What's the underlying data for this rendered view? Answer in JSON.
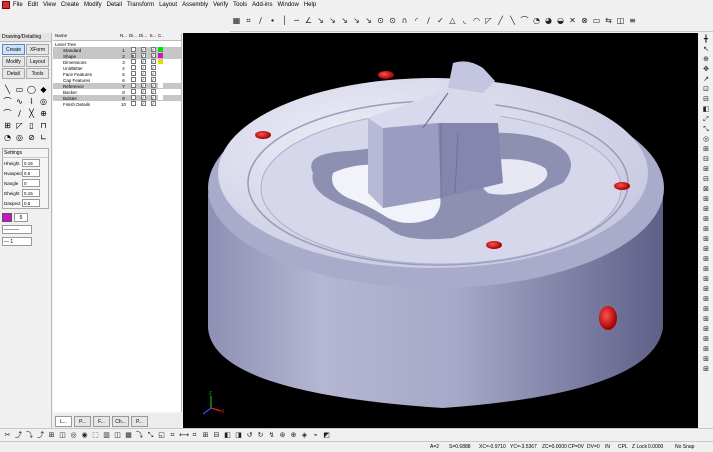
{
  "menu": [
    "File",
    "Edit",
    "View",
    "Create",
    "Modify",
    "Detail",
    "Transform",
    "Layout",
    "Assembly",
    "Verify",
    "Tools",
    "Add-ins",
    "Window",
    "Help"
  ],
  "top_toolbar_icons": [
    "▦",
    "⌗",
    "∕",
    "∙",
    "│",
    "─",
    "∠",
    "↘",
    "↘",
    "↘",
    "↘",
    "↘",
    "⊙",
    "⊙",
    "∩",
    "◜",
    "∕",
    "✓",
    "△",
    "◟",
    "◠",
    "◸",
    "╱",
    "╲",
    "⌒",
    "◔",
    "◕",
    "◒",
    "✕",
    "⊗",
    "▭",
    "⇆",
    "◫",
    "≡"
  ],
  "left_panel": {
    "title": "Drawing/Detailing",
    "tabs": [
      "Create",
      "XForm",
      "Modify",
      "Layout",
      "Detail",
      "Tools"
    ],
    "active_tab": "Create",
    "tool_icons": [
      "╲",
      "▭",
      "◯",
      "◆",
      "⌒",
      "∿",
      "⌇",
      "◎",
      "⌒",
      "∕",
      "╳",
      "⊕",
      "⊞",
      "◸",
      "▯",
      "⊓",
      "◔",
      "◎",
      "⊘",
      "∟"
    ],
    "settings": {
      "title": "Settings",
      "rows": [
        {
          "label": "Hheight",
          "value": "0.15"
        },
        {
          "label": "Nvaspect",
          "value": "0.5"
        },
        {
          "label": "Nangle",
          "value": "0"
        },
        {
          "label": "Dheight",
          "value": "0.15"
        },
        {
          "label": "Daspect",
          "value": "0.5"
        }
      ]
    },
    "color_value": "5",
    "line_style_1": "———",
    "line_style_2": "— 1"
  },
  "level_tree": {
    "headers": [
      "Name",
      "N...",
      "Di...",
      "Di...",
      "S...",
      "C..."
    ],
    "root": "Level Tree",
    "rows": [
      {
        "name": "Standard",
        "n": "1",
        "selected": true,
        "color": "#00e000"
      },
      {
        "name": "Shape",
        "n": "2",
        "selected": true,
        "color": "#d010d0"
      },
      {
        "name": "Dimensions",
        "n": "3",
        "selected": false,
        "color": "#e0e000"
      },
      {
        "name": "Unit/Bitter",
        "n": "4",
        "selected": false,
        "color": "#ffffff"
      },
      {
        "name": "Face Features",
        "n": "5",
        "selected": false,
        "color": "#ffffff"
      },
      {
        "name": "Cap Features",
        "n": "6",
        "selected": false,
        "color": "#ffffff"
      },
      {
        "name": "Reference",
        "n": "7",
        "selected": true,
        "color": "#ffffff"
      },
      {
        "name": "Backer",
        "n": "8",
        "selected": false,
        "color": "#ffffff"
      },
      {
        "name": "Bolster",
        "n": "9",
        "selected": true,
        "color": "#ffffff"
      },
      {
        "name": "Finish Details",
        "n": "10",
        "selected": false,
        "color": "#ffffff"
      }
    ]
  },
  "bottom_tabs": [
    "L...",
    "P...",
    "F...",
    "Ch...",
    "P..."
  ],
  "right_toolbar_icons": [
    "╋",
    "↖",
    "⊕",
    "✥",
    "↗",
    "⊡",
    "⊟",
    "◧",
    "⤢",
    "⤡",
    "◎",
    "⊞",
    "⊟",
    "⊞",
    "⊟",
    "⊠",
    "⊞",
    "⊞",
    "⊞",
    "⊞",
    "⊞",
    "⊞",
    "⊞",
    "⊞",
    "⊞",
    "⊞",
    "⊞",
    "⊞",
    "⊞",
    "⊞",
    "⊞",
    "⊞",
    "⊞",
    "⊞"
  ],
  "bottom_toolbar_icons": [
    "✂",
    "⤴",
    "⤵",
    "⤴",
    "⊞",
    "◫",
    "◎",
    "◉",
    "⬚",
    "▥",
    "◫",
    "▦",
    "⤵",
    "⤡",
    "◱",
    "⌗",
    "⟷",
    "⌗",
    "⊞",
    "⊟",
    "◧",
    "◨",
    "↺",
    "↻",
    "↯",
    "⊛",
    "⊕",
    "◈",
    "⌁",
    "◩"
  ],
  "status": {
    "a": "A=2",
    "s": "S=0.6888",
    "xc": "XC=-0.9710",
    "yc": "YC=-3.5367",
    "zc": "ZC=0.0000",
    "cp": "CP=0V",
    "dv": "DV=0",
    "units": "IN",
    "cpl": "CPL",
    "zlock": "Z Lock",
    "zlock_value": "0.0000",
    "snap": "No Snap"
  },
  "colors": {
    "viewport_bg": "#000000",
    "part_base": "#c7c8e0",
    "hole": "#e01010"
  }
}
